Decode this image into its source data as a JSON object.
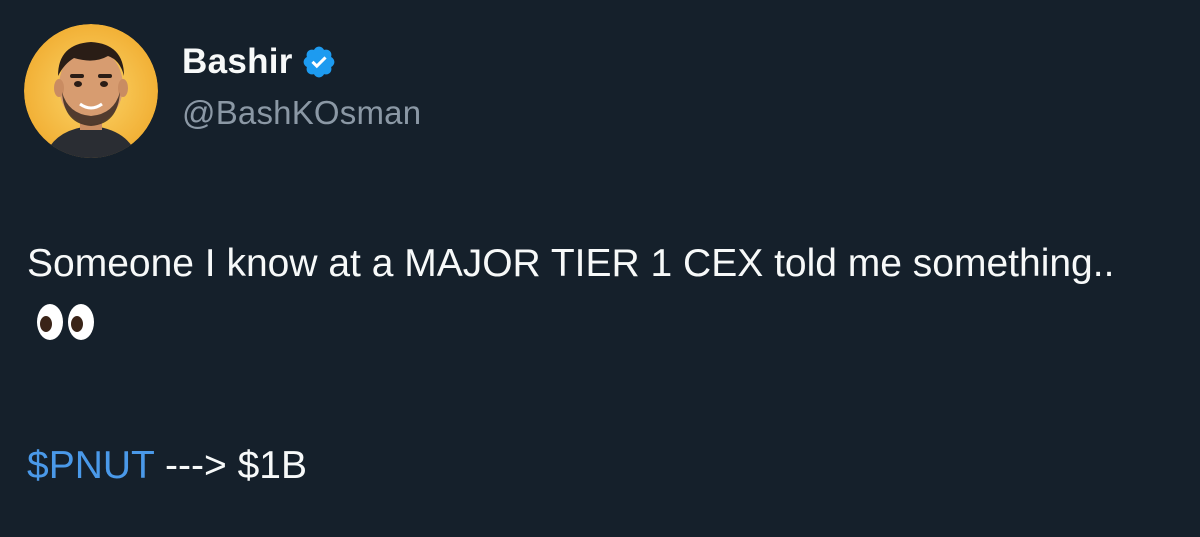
{
  "author": {
    "display_name": "Bashir",
    "handle": "@BashKOsman",
    "verified": true,
    "avatar_icon": "cartoon-avatar",
    "verified_icon": "verified-badge-icon"
  },
  "tweet": {
    "text": "Someone I know at a MAJOR TIER 1 CEX told me something..",
    "emoji_icon": "eyes-emoji-icon",
    "cashtag": "$PNUT",
    "arrow_text": " ---> $1B"
  },
  "colors": {
    "background": "#15202b",
    "text": "#f7f9f9",
    "muted": "#8b98a5",
    "link": "#4a99e9",
    "verified": "#1d9bf0"
  }
}
